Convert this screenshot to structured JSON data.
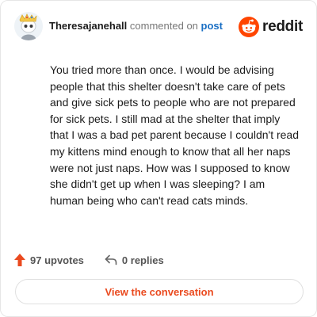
{
  "header": {
    "username": "Theresajanehall",
    "action_text": "commented on",
    "target_link": "post",
    "brand": "reddit"
  },
  "comment": {
    "text": "You tried more than once. I would be advising people that this shelter doesn't take care of pets and give sick pets to people who are not prepared for sick pets. I still mad at the shelter that imply that I was a bad pet parent because I couldn't read my kittens mind enough to know that all her naps were not just naps. How was I supposed to know she didn't get up when I was sleeping? I am human being who can't read cats minds."
  },
  "stats": {
    "upvotes_label": "97 upvotes",
    "replies_label": "0 replies"
  },
  "footer": {
    "view_button": "View the conversation"
  },
  "colors": {
    "accent": "#ea4a1f",
    "reddit_orange": "#ff4500",
    "link": "#1a6fc4"
  },
  "icons": {
    "avatar": "snoo-avatar-icon",
    "logo": "reddit-snoo-icon",
    "upvote": "upvote-arrow-icon",
    "reply": "reply-arrow-icon"
  }
}
